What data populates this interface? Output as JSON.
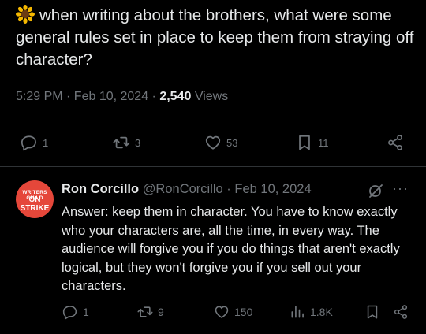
{
  "tweet": {
    "emoji_icon": "sunflower-icon",
    "text": "when writing about the brothers, what were some general rules set in place to keep them from straying off character?",
    "time": "5:29 PM · Feb 10, 2024 · ",
    "views_count": "2,540",
    "views_label": " Views",
    "stats": {
      "replies": "1",
      "retweets": "3",
      "likes": "53",
      "bookmarks": "11"
    }
  },
  "reply": {
    "avatar_line1": "WRITERS GUILD",
    "avatar_line2": "ON STRIKE",
    "name": "Ron Corcillo",
    "handle": "@RonCorcillo · Feb 10, 2024",
    "text": "Answer: keep them in character. You have to know exactly who your characters are, all the time, in every way. The audience will forgive you if you do things that aren't exactly logical, but they won't forgive you if you sell out your characters.",
    "more_label": "···",
    "stats": {
      "replies": "1",
      "retweets": "9",
      "likes": "150",
      "views": "1.8K"
    }
  },
  "colors": {
    "background": "#000000",
    "text": "#e7e9ea",
    "muted": "#71767b",
    "divider": "#2f3336",
    "avatar": "#e5473a"
  }
}
